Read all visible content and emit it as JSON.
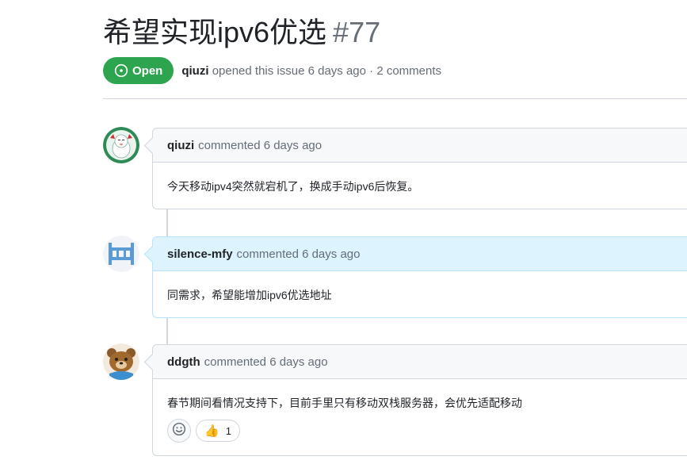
{
  "issue": {
    "title": "希望实现ipv6优选",
    "number": "#77",
    "state": "Open",
    "author": "qiuzi",
    "meta_text": "opened this issue 6 days ago · 2 comments"
  },
  "comments": [
    {
      "author": "qiuzi",
      "time_text": "commented 6 days ago",
      "body": "今天移动ipv4突然就宕机了，换成手动ipv6后恢复。"
    },
    {
      "author": "silence-mfy",
      "time_text": "commented 6 days ago",
      "body": "同需求，希望能增加ipv6优选地址"
    },
    {
      "author": "ddgth",
      "time_text": "commented 6 days ago",
      "body": "春节期间看情况支持下，目前手里只有移动双栈服务器，会优先适配移动",
      "reactions": [
        {
          "emoji": "👍",
          "count": "1"
        }
      ]
    }
  ],
  "colors": {
    "open_badge": "#2da44e",
    "highlight_header": "#ddf4ff",
    "border": "#d0d7de",
    "muted_text": "#656d76"
  },
  "icons": {
    "state": "issue-opened-icon",
    "add_reaction": "smiley-icon"
  }
}
